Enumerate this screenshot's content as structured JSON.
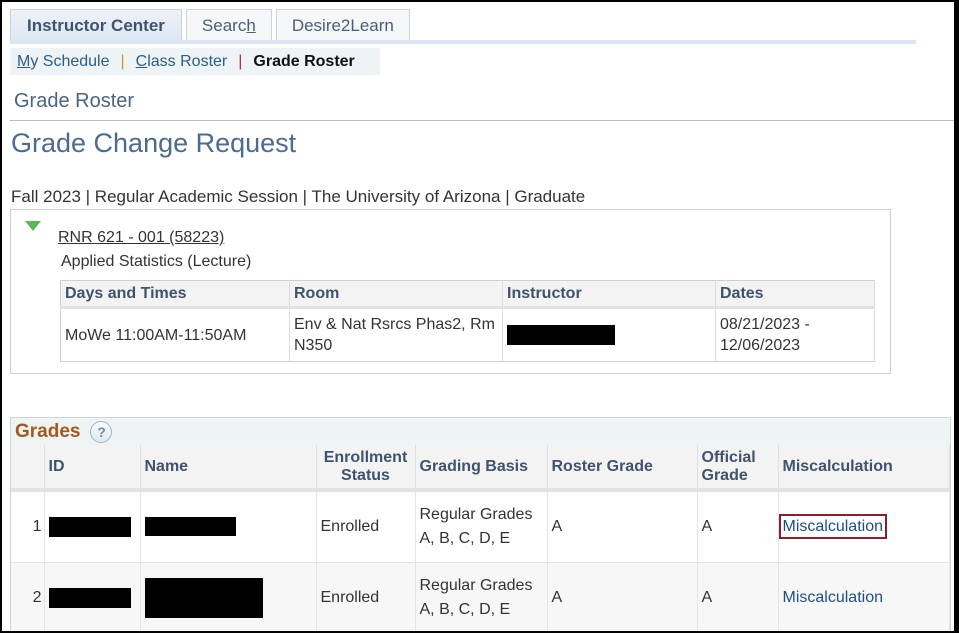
{
  "tabs": [
    {
      "label": "Instructor Center",
      "active": true
    },
    {
      "label_pre": "Searc",
      "label_u": "h",
      "active": false
    },
    {
      "label": "Desire2Learn",
      "active": false
    }
  ],
  "subnav": {
    "my_schedule_u": "M",
    "my_schedule_rest": "y Schedule",
    "class_roster_u": "C",
    "class_roster_rest": "lass Roster",
    "sep": "|",
    "current": "Grade Roster"
  },
  "page_title": "Grade Roster",
  "main_title": "Grade Change Request",
  "term_line": "Fall 2023 | Regular Academic Session | The University of Arizona | Graduate",
  "class": {
    "link": "RNR 621 - 001 (58223)",
    "description": "Applied Statistics (Lecture)",
    "meetings": {
      "headers": [
        "Days and Times",
        "Room",
        "Instructor",
        "Dates"
      ],
      "rows": [
        {
          "days_times": "MoWe 11:00AM-11:50AM",
          "room": "Env & Nat Rsrcs Phas2, Rm N350",
          "instructor": "[redacted]",
          "dates": "08/21/2023 - 12/06/2023"
        }
      ]
    }
  },
  "grades": {
    "title": "Grades",
    "help_icon": "?",
    "headers": [
      "",
      "ID",
      "Name",
      "Enrollment Status",
      "Grading Basis",
      "Roster Grade",
      "Official Grade",
      "Miscalculation"
    ],
    "rows": [
      {
        "num": "1",
        "id": "[redacted]",
        "name": "[redacted]",
        "status": "Enrolled",
        "basis": "Regular Grades A, B, C, D, E",
        "roster": "A",
        "official": "A",
        "link": "Miscalculation",
        "highlighted": true
      },
      {
        "num": "2",
        "id": "[redacted]",
        "name": "[redacted]",
        "status": "Enrolled",
        "basis": "Regular Grades A, B, C, D, E",
        "roster": "A",
        "official": "A",
        "link": "Miscalculation",
        "highlighted": false
      }
    ]
  },
  "colors": {
    "highlight_box": "#8b1f2f",
    "link": "#1f4f86",
    "section_title": "#a5581c",
    "heading": "#4d6a8f"
  }
}
